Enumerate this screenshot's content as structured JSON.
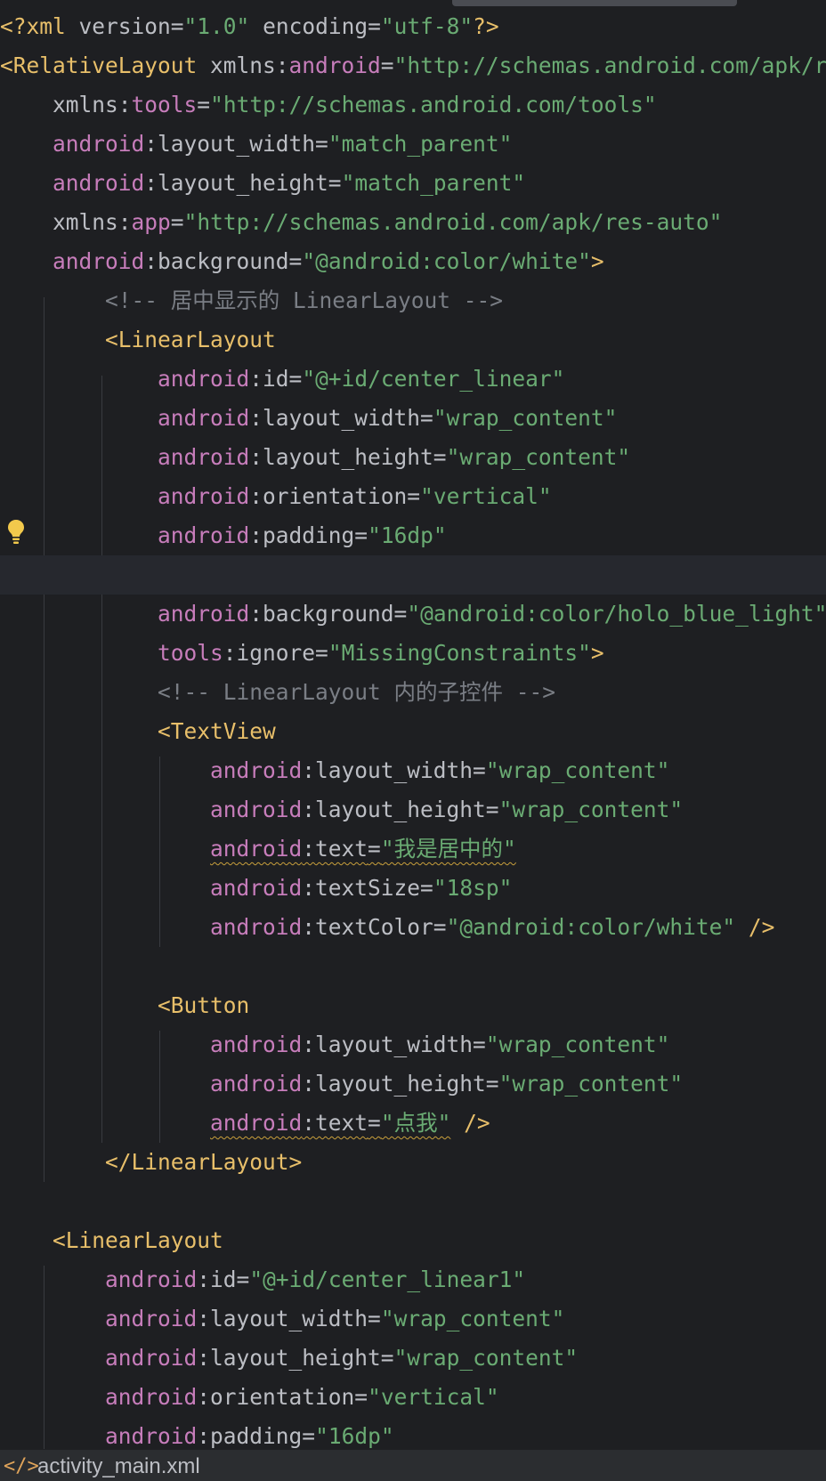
{
  "editor": {
    "lines": [
      [
        {
          "t": "tag",
          "v": "<?xml "
        },
        {
          "t": "attr",
          "v": "version"
        },
        {
          "t": "pl",
          "v": "="
        },
        {
          "t": "str",
          "v": "\"1.0\""
        },
        {
          "t": "attr",
          "v": " encoding"
        },
        {
          "t": "pl",
          "v": "="
        },
        {
          "t": "str",
          "v": "\"utf-8\""
        },
        {
          "t": "tag",
          "v": "?>"
        }
      ],
      [
        {
          "t": "tag",
          "v": "<RelativeLayout "
        },
        {
          "t": "attr",
          "v": "xmlns:"
        },
        {
          "t": "ns",
          "v": "android"
        },
        {
          "t": "pl",
          "v": "="
        },
        {
          "t": "str",
          "v": "\"http://schemas.android.com/apk/res/android\""
        }
      ],
      [
        {
          "t": "pl",
          "v": "    "
        },
        {
          "t": "attr",
          "v": "xmlns:"
        },
        {
          "t": "ns",
          "v": "tools"
        },
        {
          "t": "pl",
          "v": "="
        },
        {
          "t": "str",
          "v": "\"http://schemas.android.com/tools\""
        }
      ],
      [
        {
          "t": "pl",
          "v": "    "
        },
        {
          "t": "ns",
          "v": "android"
        },
        {
          "t": "attr",
          "v": ":layout_width"
        },
        {
          "t": "pl",
          "v": "="
        },
        {
          "t": "str",
          "v": "\"match_parent\""
        }
      ],
      [
        {
          "t": "pl",
          "v": "    "
        },
        {
          "t": "ns",
          "v": "android"
        },
        {
          "t": "attr",
          "v": ":layout_height"
        },
        {
          "t": "pl",
          "v": "="
        },
        {
          "t": "str",
          "v": "\"match_parent\""
        }
      ],
      [
        {
          "t": "pl",
          "v": "    "
        },
        {
          "t": "attr",
          "v": "xmlns:"
        },
        {
          "t": "ns",
          "v": "app"
        },
        {
          "t": "pl",
          "v": "="
        },
        {
          "t": "str",
          "v": "\"http://schemas.android.com/apk/res-auto\""
        }
      ],
      [
        {
          "t": "pl",
          "v": "    "
        },
        {
          "t": "ns",
          "v": "android"
        },
        {
          "t": "attr",
          "v": ":background"
        },
        {
          "t": "pl",
          "v": "="
        },
        {
          "t": "str",
          "v": "\"@android:color/white\""
        },
        {
          "t": "tag",
          "v": ">"
        }
      ],
      [
        {
          "t": "pl",
          "v": "        "
        },
        {
          "t": "cm",
          "v": "<!-- 居中显示的 LinearLayout -->"
        }
      ],
      [
        {
          "t": "pl",
          "v": "        "
        },
        {
          "t": "tag",
          "v": "<LinearLayout"
        }
      ],
      [
        {
          "t": "pl",
          "v": "            "
        },
        {
          "t": "ns",
          "v": "android"
        },
        {
          "t": "attr",
          "v": ":id"
        },
        {
          "t": "pl",
          "v": "="
        },
        {
          "t": "str",
          "v": "\"@+id/center_linear\""
        }
      ],
      [
        {
          "t": "pl",
          "v": "            "
        },
        {
          "t": "ns",
          "v": "android"
        },
        {
          "t": "attr",
          "v": ":layout_width"
        },
        {
          "t": "pl",
          "v": "="
        },
        {
          "t": "str",
          "v": "\"wrap_content\""
        }
      ],
      [
        {
          "t": "pl",
          "v": "            "
        },
        {
          "t": "ns",
          "v": "android"
        },
        {
          "t": "attr",
          "v": ":layout_height"
        },
        {
          "t": "pl",
          "v": "="
        },
        {
          "t": "str",
          "v": "\"wrap_content\""
        }
      ],
      [
        {
          "t": "pl",
          "v": "            "
        },
        {
          "t": "ns",
          "v": "android"
        },
        {
          "t": "attr",
          "v": ":orientation"
        },
        {
          "t": "pl",
          "v": "="
        },
        {
          "t": "str",
          "v": "\"vertical\""
        }
      ],
      [
        {
          "t": "pl",
          "v": "            "
        },
        {
          "t": "ns",
          "v": "android"
        },
        {
          "t": "attr",
          "v": ":padding"
        },
        {
          "t": "pl",
          "v": "="
        },
        {
          "t": "str",
          "v": "\"16dp\""
        }
      ],
      [],
      [
        {
          "t": "pl",
          "v": "            "
        },
        {
          "t": "ns",
          "v": "android"
        },
        {
          "t": "attr",
          "v": ":background"
        },
        {
          "t": "pl",
          "v": "="
        },
        {
          "t": "str",
          "v": "\"@android:color/holo_blue_light\""
        }
      ],
      [
        {
          "t": "pl",
          "v": "            "
        },
        {
          "t": "ns",
          "v": "tools"
        },
        {
          "t": "attr",
          "v": ":ignore"
        },
        {
          "t": "pl",
          "v": "="
        },
        {
          "t": "str",
          "v": "\"MissingConstraints\""
        },
        {
          "t": "tag",
          "v": ">"
        }
      ],
      [
        {
          "t": "pl",
          "v": "            "
        },
        {
          "t": "cm",
          "v": "<!-- LinearLayout 内的子控件 -->"
        }
      ],
      [
        {
          "t": "pl",
          "v": "            "
        },
        {
          "t": "tag",
          "v": "<TextView"
        }
      ],
      [
        {
          "t": "pl",
          "v": "                "
        },
        {
          "t": "ns",
          "v": "android"
        },
        {
          "t": "attr",
          "v": ":layout_width"
        },
        {
          "t": "pl",
          "v": "="
        },
        {
          "t": "str",
          "v": "\"wrap_content\""
        }
      ],
      [
        {
          "t": "pl",
          "v": "                "
        },
        {
          "t": "ns",
          "v": "android"
        },
        {
          "t": "attr",
          "v": ":layout_height"
        },
        {
          "t": "pl",
          "v": "="
        },
        {
          "t": "str",
          "v": "\"wrap_content\""
        }
      ],
      [
        {
          "t": "pl",
          "v": "                "
        },
        {
          "t": "ns",
          "v": "android",
          "w": true
        },
        {
          "t": "attr",
          "v": ":text",
          "w": true
        },
        {
          "t": "pl",
          "v": "=",
          "w": true
        },
        {
          "t": "str",
          "v": "\"我是居中的\"",
          "w": true
        }
      ],
      [
        {
          "t": "pl",
          "v": "                "
        },
        {
          "t": "ns",
          "v": "android"
        },
        {
          "t": "attr",
          "v": ":textSize"
        },
        {
          "t": "pl",
          "v": "="
        },
        {
          "t": "str",
          "v": "\"18sp\""
        }
      ],
      [
        {
          "t": "pl",
          "v": "                "
        },
        {
          "t": "ns",
          "v": "android"
        },
        {
          "t": "attr",
          "v": ":textColor"
        },
        {
          "t": "pl",
          "v": "="
        },
        {
          "t": "str",
          "v": "\"@android:color/white\""
        },
        {
          "t": "tag",
          "v": " />"
        }
      ],
      [],
      [
        {
          "t": "pl",
          "v": "            "
        },
        {
          "t": "tag",
          "v": "<Button"
        }
      ],
      [
        {
          "t": "pl",
          "v": "                "
        },
        {
          "t": "ns",
          "v": "android"
        },
        {
          "t": "attr",
          "v": ":layout_width"
        },
        {
          "t": "pl",
          "v": "="
        },
        {
          "t": "str",
          "v": "\"wrap_content\""
        }
      ],
      [
        {
          "t": "pl",
          "v": "                "
        },
        {
          "t": "ns",
          "v": "android"
        },
        {
          "t": "attr",
          "v": ":layout_height"
        },
        {
          "t": "pl",
          "v": "="
        },
        {
          "t": "str",
          "v": "\"wrap_content\""
        }
      ],
      [
        {
          "t": "pl",
          "v": "                "
        },
        {
          "t": "ns",
          "v": "android",
          "w": true
        },
        {
          "t": "attr",
          "v": ":text",
          "w": true
        },
        {
          "t": "pl",
          "v": "=",
          "w": true
        },
        {
          "t": "str",
          "v": "\"点我\"",
          "w": true
        },
        {
          "t": "tag",
          "v": " />"
        }
      ],
      [
        {
          "t": "pl",
          "v": "        "
        },
        {
          "t": "tag",
          "v": "</LinearLayout>"
        }
      ],
      [],
      [
        {
          "t": "pl",
          "v": "    "
        },
        {
          "t": "tag",
          "v": "<LinearLayout"
        }
      ],
      [
        {
          "t": "pl",
          "v": "        "
        },
        {
          "t": "ns",
          "v": "android"
        },
        {
          "t": "attr",
          "v": ":id"
        },
        {
          "t": "pl",
          "v": "="
        },
        {
          "t": "str",
          "v": "\"@+id/center_linear1\""
        }
      ],
      [
        {
          "t": "pl",
          "v": "        "
        },
        {
          "t": "ns",
          "v": "android"
        },
        {
          "t": "attr",
          "v": ":layout_width"
        },
        {
          "t": "pl",
          "v": "="
        },
        {
          "t": "str",
          "v": "\"wrap_content\""
        }
      ],
      [
        {
          "t": "pl",
          "v": "        "
        },
        {
          "t": "ns",
          "v": "android"
        },
        {
          "t": "attr",
          "v": ":layout_height"
        },
        {
          "t": "pl",
          "v": "="
        },
        {
          "t": "str",
          "v": "\"wrap_content\""
        }
      ],
      [
        {
          "t": "pl",
          "v": "        "
        },
        {
          "t": "ns",
          "v": "android"
        },
        {
          "t": "attr",
          "v": ":orientation"
        },
        {
          "t": "pl",
          "v": "="
        },
        {
          "t": "str",
          "v": "\"vertical\""
        }
      ],
      [
        {
          "t": "pl",
          "v": "        "
        },
        {
          "t": "ns",
          "v": "android"
        },
        {
          "t": "attr",
          "v": ":padding"
        },
        {
          "t": "pl",
          "v": "="
        },
        {
          "t": "str",
          "v": "\"16dp\""
        }
      ]
    ],
    "current_line": 14,
    "hint_icon": "lightbulb-icon"
  },
  "statusbar": {
    "file_icon": "xml-file-icon",
    "file_glyph": "</>",
    "file_name": "activity_main.xml"
  }
}
